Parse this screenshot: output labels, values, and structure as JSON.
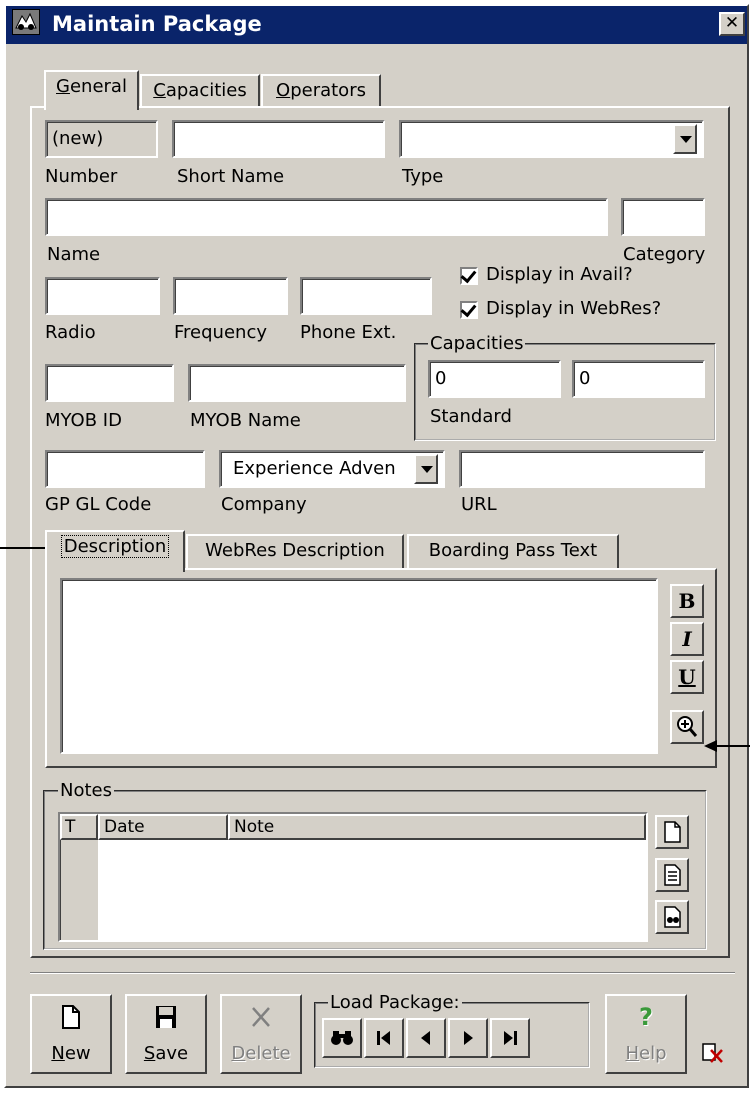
{
  "window": {
    "title": "Maintain Package",
    "close_glyph": "✕"
  },
  "main_tabs": [
    {
      "label": "General",
      "underline": "G",
      "rest": "eneral"
    },
    {
      "label": "Capacities",
      "underline": "C",
      "rest": "apacities"
    },
    {
      "label": "Operators",
      "underline": "O",
      "rest": "perators"
    }
  ],
  "general": {
    "number": {
      "label": "Number",
      "value": "(new)"
    },
    "short_name": {
      "label": "Short Name",
      "value": ""
    },
    "type": {
      "label": "Type",
      "value": ""
    },
    "name": {
      "label": "Name",
      "value": ""
    },
    "category": {
      "label": "Category",
      "value": ""
    },
    "display_in_avail": {
      "label": "Display in Avail?",
      "checked": true
    },
    "display_in_webres": {
      "label": "Display in WebRes?",
      "checked": true
    },
    "radio": {
      "label": "Radio",
      "value": ""
    },
    "frequency": {
      "label": "Frequency",
      "value": ""
    },
    "phone_ext": {
      "label": "Phone Ext.",
      "value": ""
    },
    "capacities_group": {
      "label": "Capacities",
      "standard_label": "Standard",
      "value1": "0",
      "value2": "0"
    },
    "myob_id": {
      "label": "MYOB ID",
      "value": ""
    },
    "myob_name": {
      "label": "MYOB Name",
      "value": ""
    },
    "gp_gl_code": {
      "label": "GP GL Code",
      "value": ""
    },
    "company": {
      "label": "Company",
      "value": "Experience Adven"
    },
    "url": {
      "label": "URL",
      "value": ""
    }
  },
  "desc_tabs": [
    {
      "label": "Description"
    },
    {
      "label": "WebRes Description"
    },
    {
      "label": "Boarding Pass Text"
    }
  ],
  "format_buttons": {
    "bold": "B",
    "italic": "I",
    "underline": "U",
    "zoom_icon": "zoom-in-icon"
  },
  "notes": {
    "label": "Notes",
    "columns": [
      "T",
      "Date",
      "Note"
    ],
    "side_icons": [
      "new-note-icon",
      "edit-note-icon",
      "find-note-icon"
    ]
  },
  "toolbar": {
    "new": {
      "label": "New",
      "u": "N",
      "rest": "ew"
    },
    "save": {
      "label": "Save",
      "u": "S",
      "rest": "ave"
    },
    "delete": {
      "label": "Delete",
      "u": "D",
      "rest": "elete"
    },
    "load_package": {
      "label": "Load Package:"
    },
    "help": {
      "label": "Help",
      "u": "H",
      "rest": "elp"
    }
  },
  "colors": {
    "face": "#d4d0c8",
    "title_bar": "#0a246a",
    "window_bg": "#ffffff"
  }
}
